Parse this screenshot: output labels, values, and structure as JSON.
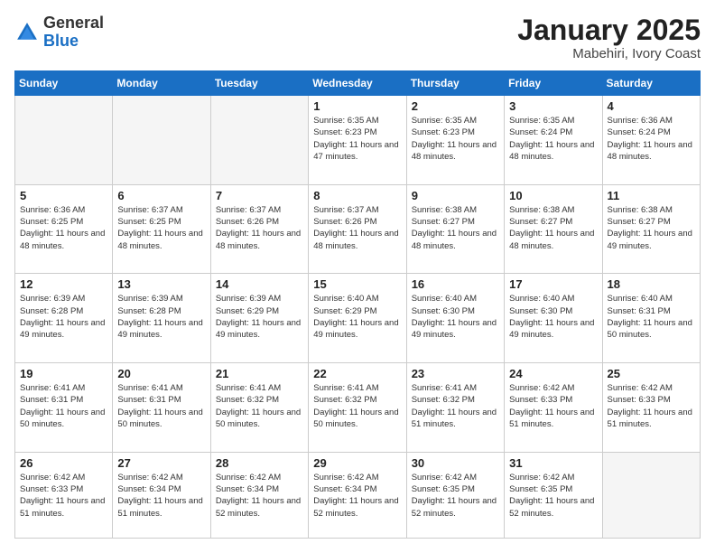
{
  "logo": {
    "general": "General",
    "blue": "Blue"
  },
  "title": {
    "month_year": "January 2025",
    "location": "Mabehiri, Ivory Coast"
  },
  "weekdays": [
    "Sunday",
    "Monday",
    "Tuesday",
    "Wednesday",
    "Thursday",
    "Friday",
    "Saturday"
  ],
  "weeks": [
    [
      {
        "day": null,
        "info": null
      },
      {
        "day": null,
        "info": null
      },
      {
        "day": null,
        "info": null
      },
      {
        "day": "1",
        "info": "Sunrise: 6:35 AM\nSunset: 6:23 PM\nDaylight: 11 hours and 47 minutes."
      },
      {
        "day": "2",
        "info": "Sunrise: 6:35 AM\nSunset: 6:23 PM\nDaylight: 11 hours and 48 minutes."
      },
      {
        "day": "3",
        "info": "Sunrise: 6:35 AM\nSunset: 6:24 PM\nDaylight: 11 hours and 48 minutes."
      },
      {
        "day": "4",
        "info": "Sunrise: 6:36 AM\nSunset: 6:24 PM\nDaylight: 11 hours and 48 minutes."
      }
    ],
    [
      {
        "day": "5",
        "info": "Sunrise: 6:36 AM\nSunset: 6:25 PM\nDaylight: 11 hours and 48 minutes."
      },
      {
        "day": "6",
        "info": "Sunrise: 6:37 AM\nSunset: 6:25 PM\nDaylight: 11 hours and 48 minutes."
      },
      {
        "day": "7",
        "info": "Sunrise: 6:37 AM\nSunset: 6:26 PM\nDaylight: 11 hours and 48 minutes."
      },
      {
        "day": "8",
        "info": "Sunrise: 6:37 AM\nSunset: 6:26 PM\nDaylight: 11 hours and 48 minutes."
      },
      {
        "day": "9",
        "info": "Sunrise: 6:38 AM\nSunset: 6:27 PM\nDaylight: 11 hours and 48 minutes."
      },
      {
        "day": "10",
        "info": "Sunrise: 6:38 AM\nSunset: 6:27 PM\nDaylight: 11 hours and 48 minutes."
      },
      {
        "day": "11",
        "info": "Sunrise: 6:38 AM\nSunset: 6:27 PM\nDaylight: 11 hours and 49 minutes."
      }
    ],
    [
      {
        "day": "12",
        "info": "Sunrise: 6:39 AM\nSunset: 6:28 PM\nDaylight: 11 hours and 49 minutes."
      },
      {
        "day": "13",
        "info": "Sunrise: 6:39 AM\nSunset: 6:28 PM\nDaylight: 11 hours and 49 minutes."
      },
      {
        "day": "14",
        "info": "Sunrise: 6:39 AM\nSunset: 6:29 PM\nDaylight: 11 hours and 49 minutes."
      },
      {
        "day": "15",
        "info": "Sunrise: 6:40 AM\nSunset: 6:29 PM\nDaylight: 11 hours and 49 minutes."
      },
      {
        "day": "16",
        "info": "Sunrise: 6:40 AM\nSunset: 6:30 PM\nDaylight: 11 hours and 49 minutes."
      },
      {
        "day": "17",
        "info": "Sunrise: 6:40 AM\nSunset: 6:30 PM\nDaylight: 11 hours and 49 minutes."
      },
      {
        "day": "18",
        "info": "Sunrise: 6:40 AM\nSunset: 6:31 PM\nDaylight: 11 hours and 50 minutes."
      }
    ],
    [
      {
        "day": "19",
        "info": "Sunrise: 6:41 AM\nSunset: 6:31 PM\nDaylight: 11 hours and 50 minutes."
      },
      {
        "day": "20",
        "info": "Sunrise: 6:41 AM\nSunset: 6:31 PM\nDaylight: 11 hours and 50 minutes."
      },
      {
        "day": "21",
        "info": "Sunrise: 6:41 AM\nSunset: 6:32 PM\nDaylight: 11 hours and 50 minutes."
      },
      {
        "day": "22",
        "info": "Sunrise: 6:41 AM\nSunset: 6:32 PM\nDaylight: 11 hours and 50 minutes."
      },
      {
        "day": "23",
        "info": "Sunrise: 6:41 AM\nSunset: 6:32 PM\nDaylight: 11 hours and 51 minutes."
      },
      {
        "day": "24",
        "info": "Sunrise: 6:42 AM\nSunset: 6:33 PM\nDaylight: 11 hours and 51 minutes."
      },
      {
        "day": "25",
        "info": "Sunrise: 6:42 AM\nSunset: 6:33 PM\nDaylight: 11 hours and 51 minutes."
      }
    ],
    [
      {
        "day": "26",
        "info": "Sunrise: 6:42 AM\nSunset: 6:33 PM\nDaylight: 11 hours and 51 minutes."
      },
      {
        "day": "27",
        "info": "Sunrise: 6:42 AM\nSunset: 6:34 PM\nDaylight: 11 hours and 51 minutes."
      },
      {
        "day": "28",
        "info": "Sunrise: 6:42 AM\nSunset: 6:34 PM\nDaylight: 11 hours and 52 minutes."
      },
      {
        "day": "29",
        "info": "Sunrise: 6:42 AM\nSunset: 6:34 PM\nDaylight: 11 hours and 52 minutes."
      },
      {
        "day": "30",
        "info": "Sunrise: 6:42 AM\nSunset: 6:35 PM\nDaylight: 11 hours and 52 minutes."
      },
      {
        "day": "31",
        "info": "Sunrise: 6:42 AM\nSunset: 6:35 PM\nDaylight: 11 hours and 52 minutes."
      },
      {
        "day": null,
        "info": null
      }
    ]
  ]
}
